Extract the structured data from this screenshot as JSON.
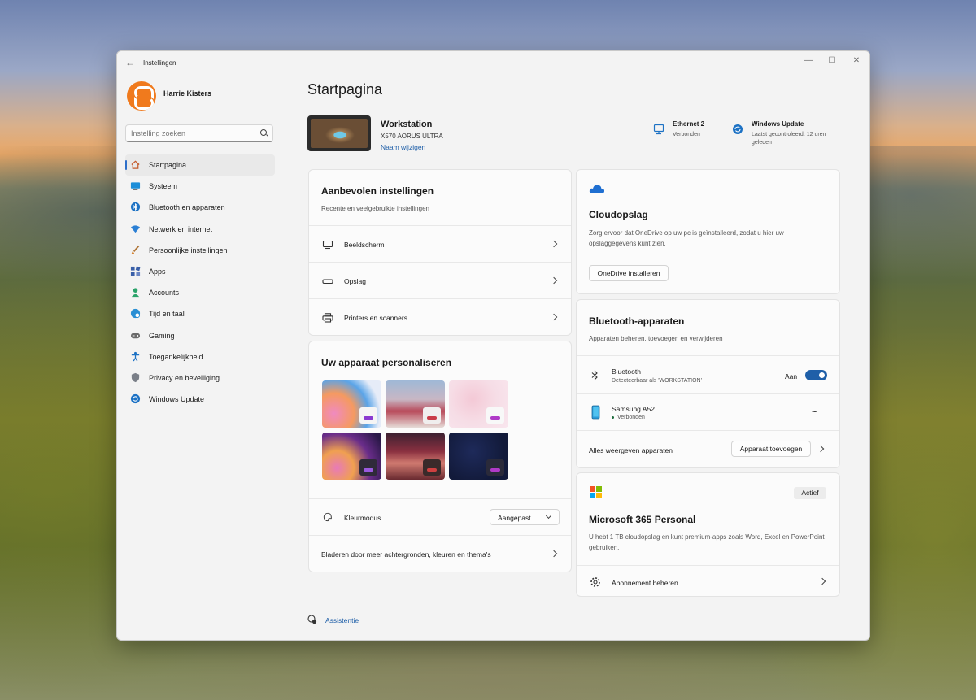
{
  "window": {
    "title": "Instellingen"
  },
  "profile": {
    "name": "Harrie Kisters"
  },
  "search": {
    "placeholder": "Instelling zoeken"
  },
  "sidebar": {
    "items": [
      {
        "label": "Startpagina",
        "icon": "home-icon"
      },
      {
        "label": "Systeem",
        "icon": "monitor-icon"
      },
      {
        "label": "Bluetooth en apparaten",
        "icon": "bluetooth-icon"
      },
      {
        "label": "Netwerk en internet",
        "icon": "wifi-icon"
      },
      {
        "label": "Persoonlijke instellingen",
        "icon": "brush-icon"
      },
      {
        "label": "Apps",
        "icon": "apps-icon"
      },
      {
        "label": "Accounts",
        "icon": "person-icon"
      },
      {
        "label": "Tijd en taal",
        "icon": "globe-clock-icon"
      },
      {
        "label": "Gaming",
        "icon": "gamepad-icon"
      },
      {
        "label": "Toegankelijkheid",
        "icon": "accessibility-icon"
      },
      {
        "label": "Privacy en beveiliging",
        "icon": "shield-icon"
      },
      {
        "label": "Windows Update",
        "icon": "update-icon"
      }
    ]
  },
  "main": {
    "title": "Startpagina",
    "device": {
      "name": "Workstation",
      "model": "X570 AORUS ULTRA",
      "rename": "Naam wijzigen"
    },
    "status": {
      "network": {
        "title": "Ethernet 2",
        "sub": "Verbonden"
      },
      "update": {
        "title": "Windows Update",
        "sub": "Laatst gecontroleerd: 12 uren geleden"
      }
    },
    "recommended": {
      "title": "Aanbevolen instellingen",
      "sub": "Recente en veelgebruikte instellingen",
      "items": [
        {
          "label": "Beeldscherm",
          "icon": "display-icon"
        },
        {
          "label": "Opslag",
          "icon": "storage-icon"
        },
        {
          "label": "Printers en scanners",
          "icon": "printer-icon"
        }
      ]
    },
    "personalize": {
      "title": "Uw apparaat personaliseren",
      "color_mode_label": "Kleurmodus",
      "color_mode_value": "Aangepast",
      "browse": "Bladeren door meer achtergronden, kleuren en thema's"
    },
    "cloud": {
      "title": "Cloudopslag",
      "desc": "Zorg ervoor dat OneDrive op uw pc is geïnstalleerd, zodat u hier uw opslaggegevens kunt zien.",
      "button": "OneDrive installeren"
    },
    "bluetooth": {
      "title": "Bluetooth-apparaten",
      "sub": "Apparaten beheren, toevoegen en verwijderen",
      "bt_label": "Bluetooth",
      "bt_sub": "Detecteerbaar als 'WORKSTATION'",
      "toggle_state": "Aan",
      "phone_name": "Samsung A52",
      "phone_status": "Verbonden",
      "more": "...",
      "show_all": "Alles weergeven apparaten",
      "add_button": "Apparaat toevoegen"
    },
    "m365": {
      "badge": "Actief",
      "title": "Microsoft 365 Personal",
      "desc": "U hebt 1 TB cloudopslag en kunt premium-apps zoals Word, Excel en PowerPoint gebruiken.",
      "manage": "Abonnement beheren"
    },
    "assistant": "Assistentie"
  },
  "colors": {
    "accent": "#1f5fa8",
    "brand_orange": "#f07a1d"
  }
}
